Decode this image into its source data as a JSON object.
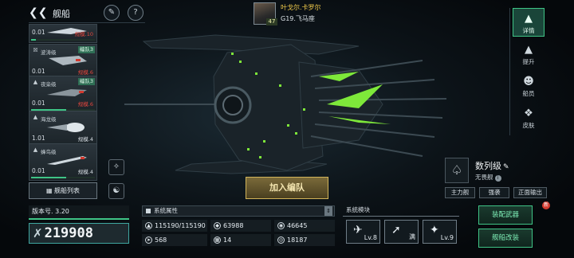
{
  "topbar": {
    "title": "舰船"
  },
  "commander": {
    "name": "叶戈尔.卡罗尔",
    "location": "G19.飞马座",
    "level": "47"
  },
  "ship_list": [
    {
      "name": "",
      "version": "0.01",
      "scale": "规模.10",
      "scale_color": "red",
      "progress": 0.08
    },
    {
      "name": "波涛级",
      "squad": "编队3",
      "version": "0.01",
      "scale": "规模.6",
      "scale_color": "red",
      "progress": 0.55
    },
    {
      "name": "夜枭级",
      "squad": "编队3",
      "version": "0.01",
      "scale": "规模.6",
      "scale_color": "red",
      "progress": 0.55
    },
    {
      "name": "海龙级",
      "version": "1.01",
      "scale": "规模.4",
      "scale_color": "white",
      "progress": 0.55
    },
    {
      "name": "蜂鸟级",
      "version": "0.01",
      "scale": "规模.4",
      "scale_color": "white",
      "progress": 0.55
    }
  ],
  "fleet_list_label": "舰船列表",
  "version_label": "版本号. 3.20",
  "power": "219908",
  "attributes": {
    "header": "系统属性",
    "items": [
      {
        "icon": "hp-icon",
        "value": "115190/115190"
      },
      {
        "icon": "armor-icon",
        "value": "63988"
      },
      {
        "icon": "shield-icon",
        "value": "46645"
      },
      {
        "icon": "speed-icon",
        "value": "568"
      },
      {
        "icon": "grid-icon",
        "value": "14"
      },
      {
        "icon": "target-icon",
        "value": "18187"
      }
    ]
  },
  "modules": {
    "header": "系统模块",
    "items": [
      {
        "icon": "module-a-icon",
        "level": "Lv.8"
      },
      {
        "icon": "module-b-icon",
        "level": "满"
      },
      {
        "icon": "module-c-icon",
        "level": "Lv.9"
      }
    ]
  },
  "join_button": "加入编队",
  "ship": {
    "class_name": "数列级",
    "sub_name": "无畏舰",
    "tags": [
      "主力舰",
      "强袭",
      "正面输出"
    ]
  },
  "right_tabs": [
    {
      "label": "详情",
      "icon": "details-icon",
      "active": true
    },
    {
      "label": "提升",
      "icon": "upgrade-icon",
      "active": false
    },
    {
      "label": "船员",
      "icon": "crew-icon",
      "active": false
    },
    {
      "label": "皮肤",
      "icon": "skin-icon",
      "active": false
    }
  ],
  "action_buttons": {
    "equip": "装配武器",
    "modify": "舰船改装",
    "notification": "新"
  },
  "colors": {
    "accent": "#3fc486",
    "warning": "#e0453d",
    "gold": "#d1b45a"
  }
}
